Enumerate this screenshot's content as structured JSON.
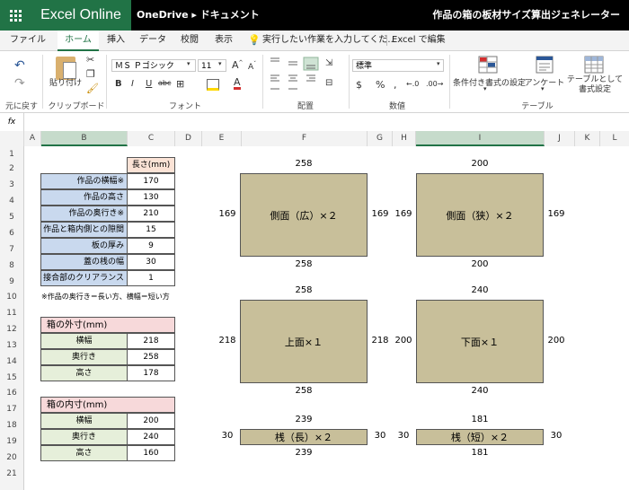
{
  "app": {
    "name": "Excel Online",
    "location": "OneDrive ▸ ドキュメント",
    "doc_title": "作品の箱の板材サイズ算出ジェネレーター"
  },
  "tabs": [
    "ファイル",
    "ホーム",
    "挿入",
    "データ",
    "校閲",
    "表示"
  ],
  "tell_me": "実行したい作業を入力してくだ...",
  "edit_in_excel": "Excel で編集",
  "ribbon": {
    "undo_group": "元に戻す",
    "paste": "貼り付け",
    "clipboard": "クリップボード",
    "font_name": "ＭＳ Ｐゴシック",
    "font_size": "11",
    "font_group": "フォント",
    "bold": "B",
    "italic": "I",
    "underline": "U",
    "strike": "abc",
    "align_group": "配置",
    "number_format": "標準",
    "number_group": "数値",
    "currency": "$",
    "percent": "%",
    "comma": ",",
    "cond_format": "条件付き書式の設定",
    "survey": "アンケート",
    "format_table": "テーブルとして書式設定",
    "table_group": "テーブル"
  },
  "formula_icon": "fx",
  "columns": [
    "A",
    "B",
    "C",
    "D",
    "E",
    "F",
    "G",
    "H",
    "I",
    "J",
    "K",
    "L"
  ],
  "rows": [
    "1",
    "2",
    "3",
    "4",
    "5",
    "6",
    "7",
    "8",
    "9",
    "10",
    "11",
    "12",
    "13",
    "14",
    "15",
    "16",
    "17",
    "18",
    "19",
    "20",
    "21"
  ],
  "input_table": {
    "header": "長さ(mm)",
    "rows": [
      {
        "label": "作品の横幅※",
        "value": "170"
      },
      {
        "label": "作品の高さ",
        "value": "130"
      },
      {
        "label": "作品の奥行き※",
        "value": "210"
      },
      {
        "label": "作品と箱内側との隙間",
        "value": "15"
      },
      {
        "label": "板の厚み",
        "value": "9"
      },
      {
        "label": "蓋の桟の幅",
        "value": "30"
      },
      {
        "label": "接合部のクリアランス",
        "value": "1"
      }
    ],
    "note": "※作品の奥行き＝長い方、横幅＝短い方"
  },
  "outer_table": {
    "title": "箱の外寸(mm)",
    "rows": [
      {
        "label": "横幅",
        "value": "218"
      },
      {
        "label": "奥行き",
        "value": "258"
      },
      {
        "label": "高さ",
        "value": "178"
      }
    ]
  },
  "inner_table": {
    "title": "箱の内寸(mm)",
    "rows": [
      {
        "label": "横幅",
        "value": "200"
      },
      {
        "label": "奥行き",
        "value": "240"
      },
      {
        "label": "高さ",
        "value": "160"
      }
    ]
  },
  "panels": [
    {
      "name": "側面（広）×２",
      "top": "258",
      "bottom": "258",
      "left": "169",
      "right": "169"
    },
    {
      "name": "側面（狭）×２",
      "top": "200",
      "bottom": "200",
      "left": "169",
      "right": "169"
    },
    {
      "name": "上面×１",
      "top": "258",
      "bottom": "258",
      "left": "218",
      "right": "218"
    },
    {
      "name": "下面×１",
      "top": "240",
      "bottom": "240",
      "left": "200",
      "right": "200"
    },
    {
      "name": "桟（長）×２",
      "top": "239",
      "bottom": "239",
      "left": "30",
      "right": "30"
    },
    {
      "name": "桟（短）×２",
      "top": "181",
      "bottom": "181",
      "left": "30",
      "right": "30"
    }
  ]
}
